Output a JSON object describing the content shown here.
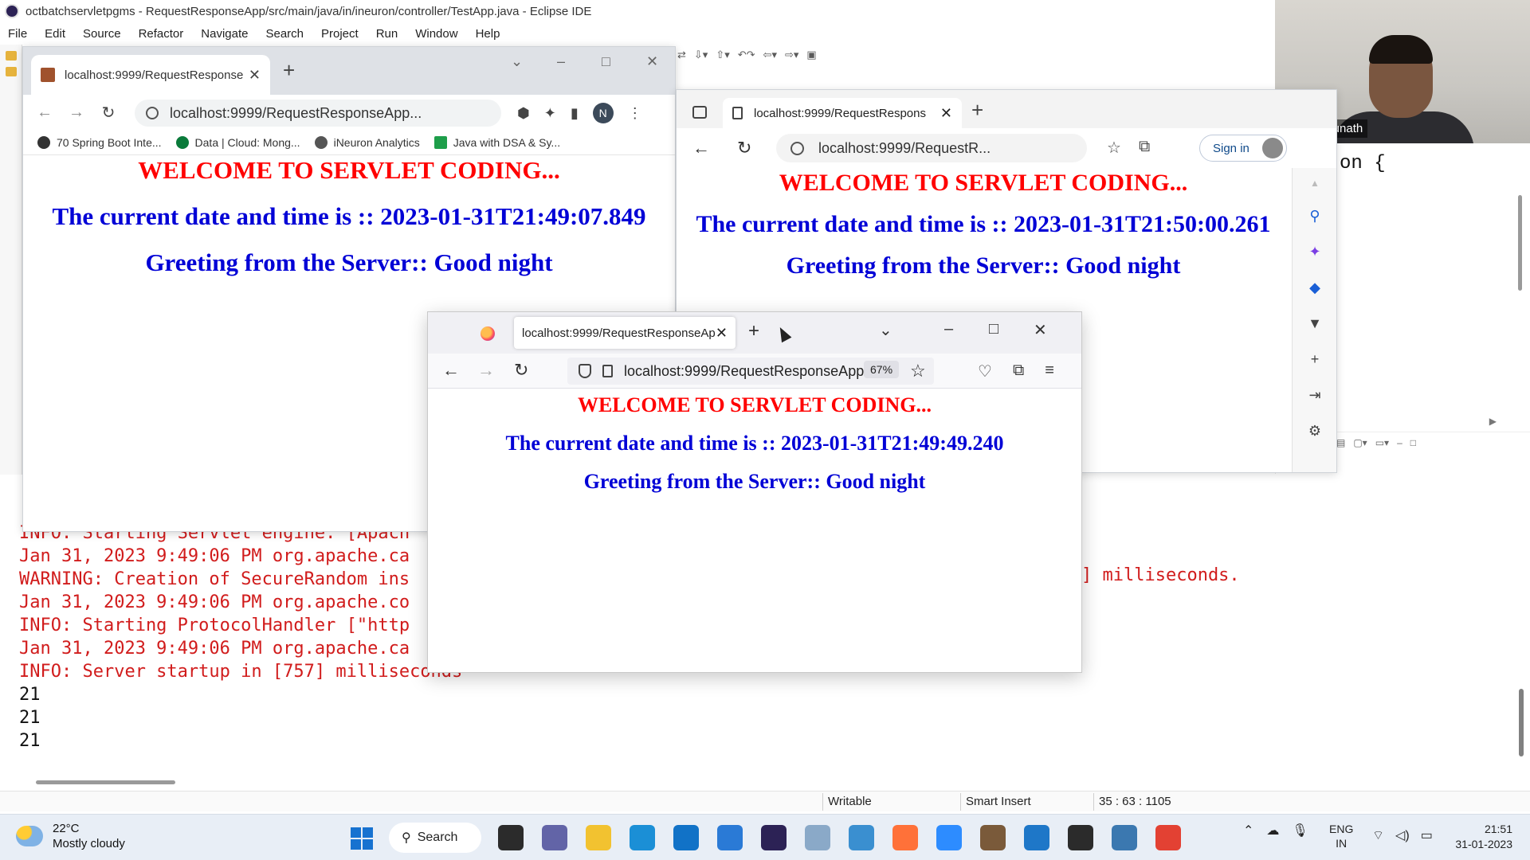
{
  "eclipse": {
    "title": "octbatchservletpgms - RequestResponseApp/src/main/java/in/ineuron/controller/TestApp.java - Eclipse IDE",
    "menu": [
      "File",
      "Edit",
      "Source",
      "Refactor",
      "Navigate",
      "Search",
      "Project",
      "Run",
      "Window",
      "Help"
    ],
    "editor_code": "on {",
    "console_lines": [
      {
        "text": "INFO: Starting Servlet engine: [Apach",
        "color": "red"
      },
      {
        "text": "Jan 31, 2023 9:49:06 PM org.apache.ca",
        "color": "red"
      },
      {
        "text": "WARNING: Creation of SecureRandom ins",
        "color": "red"
      },
      {
        "text": "Jan 31, 2023 9:49:06 PM org.apache.co",
        "color": "red"
      },
      {
        "text": "INFO: Starting ProtocolHandler [\"http",
        "color": "red"
      },
      {
        "text": "Jan 31, 2023 9:49:06 PM org.apache.ca",
        "color": "red"
      },
      {
        "text": "INFO: Server startup in [757] milliseconds",
        "color": "red"
      },
      {
        "text": "21",
        "color": "black"
      },
      {
        "text": "21",
        "color": "black"
      },
      {
        "text": "21",
        "color": "black"
      }
    ],
    "console_right_text": "] milliseconds.",
    "status": {
      "writable": "Writable",
      "insert_mode": "Smart Insert",
      "position": "35 : 63 : 1105"
    }
  },
  "webcam": {
    "name": "Nitin Manjunath"
  },
  "chrome": {
    "tab_title": "localhost:9999/RequestResponse",
    "url": "localhost:9999/RequestResponseApp...",
    "profile_initial": "N",
    "bookmarks": [
      {
        "label": "70 Spring Boot Inte...",
        "color": "#333333"
      },
      {
        "label": "Data | Cloud: Mong...",
        "color": "#0a7a3a"
      },
      {
        "label": "iNeuron Analytics",
        "color": "#555555"
      },
      {
        "label": "Java with DSA & Sy...",
        "color": "#1e9e4a"
      }
    ],
    "page": {
      "welcome": "WELCOME TO SERVLET CODING...",
      "datetime": "The current date and time is :: 2023-01-31T21:49:07.849",
      "greeting": "Greeting from the Server:: Good night"
    }
  },
  "edge": {
    "tab_title": "localhost:9999/RequestRespons",
    "url": "localhost:9999/RequestR...",
    "signin_label": "Sign in",
    "page": {
      "welcome": "WELCOME TO SERVLET CODING...",
      "datetime": "The current date and time is :: 2023-01-31T21:50:00.261",
      "greeting": "Greeting from the Server:: Good night"
    }
  },
  "firefox": {
    "tab_title": "localhost:9999/RequestResponseAp",
    "url": "localhost:9999/RequestResponseApp/",
    "zoom": "67%",
    "page": {
      "welcome": "WELCOME TO SERVLET CODING...",
      "datetime": "The current date and time is :: 2023-01-31T21:49:49.240",
      "greeting": "Greeting from the Server:: Good night"
    }
  },
  "taskbar": {
    "weather_temp": "22°C",
    "weather_desc": "Mostly cloudy",
    "search_label": "Search",
    "lang_line1": "ENG",
    "lang_line2": "IN",
    "time": "21:51",
    "date": "31-01-2023",
    "apps": [
      {
        "name": "task-view",
        "color": "#2b2b2b"
      },
      {
        "name": "teams",
        "color": "#6264a7"
      },
      {
        "name": "file-explorer",
        "color": "#f2c230"
      },
      {
        "name": "edge",
        "color": "#1b8fd6"
      },
      {
        "name": "store",
        "color": "#1172c7"
      },
      {
        "name": "mail",
        "color": "#2a7ad6"
      },
      {
        "name": "eclipse",
        "color": "#2c2255"
      },
      {
        "name": "people",
        "color": "#8aa9c8"
      },
      {
        "name": "snipping",
        "color": "#3a8fd0"
      },
      {
        "name": "firefox",
        "color": "#ff7139"
      },
      {
        "name": "zoom",
        "color": "#2d8cff"
      },
      {
        "name": "game",
        "color": "#7a5a3a"
      },
      {
        "name": "notepad",
        "color": "#1e77c8"
      },
      {
        "name": "terminal",
        "color": "#2b2b2b"
      },
      {
        "name": "python",
        "color": "#3b78b0"
      },
      {
        "name": "chrome",
        "color": "#e34133"
      }
    ]
  }
}
